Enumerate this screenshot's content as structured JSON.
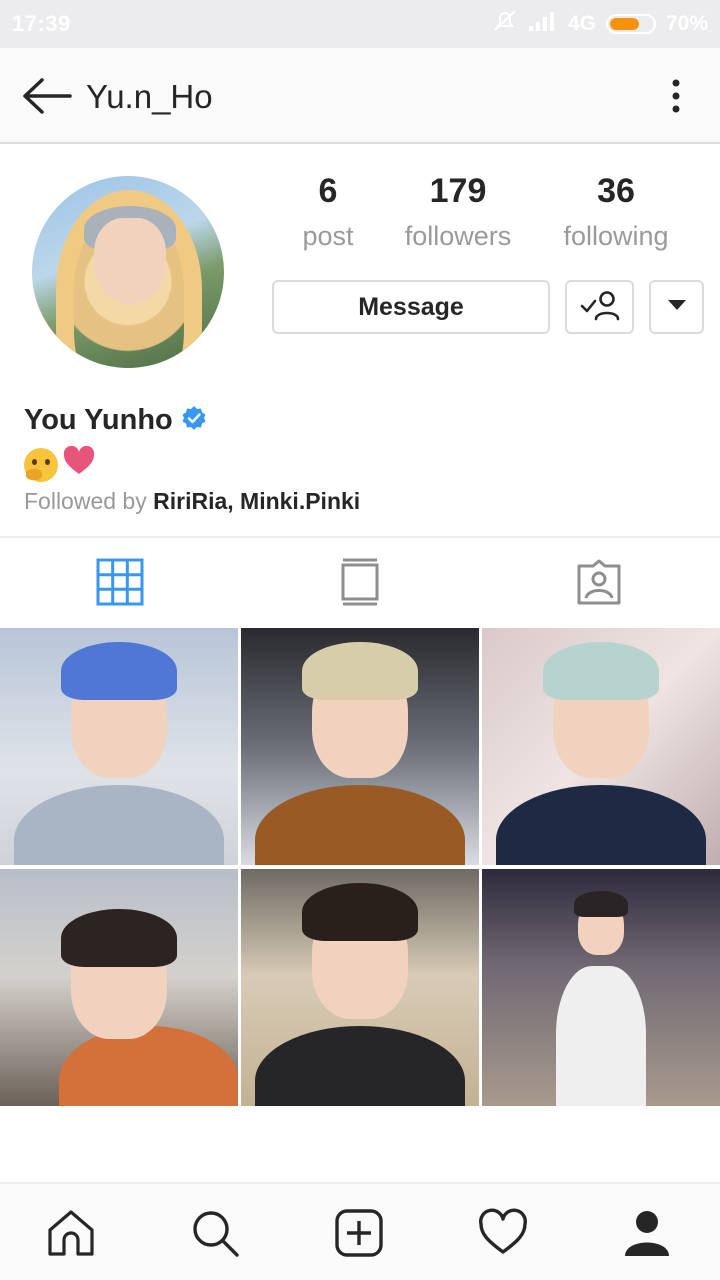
{
  "status_bar": {
    "time": "17:39",
    "network": "4G",
    "battery": "70%",
    "battery_level": 0.7,
    "icons": [
      "mute-icon",
      "signal-icon",
      "battery-icon"
    ]
  },
  "header": {
    "username": "Yu.n_Ho",
    "back_icon": "arrow-left-icon",
    "menu_icon": "more-vertical-icon"
  },
  "profile": {
    "stats": [
      {
        "value": "6",
        "label": "post"
      },
      {
        "value": "179",
        "label": "followers"
      },
      {
        "value": "36",
        "label": "following"
      }
    ],
    "message_label": "Message",
    "full_name": "You Yunho",
    "verified": true,
    "bio_emojis": [
      "thinking-face",
      "heart"
    ],
    "followed_prefix": "Followed by ",
    "followed_names": "RiriRia, Minki.Pinki"
  },
  "tabs": [
    {
      "icon": "grid-icon",
      "active": true
    },
    {
      "icon": "feed-icon",
      "active": false
    },
    {
      "icon": "tagged-icon",
      "active": false
    }
  ],
  "posts": [
    {
      "name": "post-1"
    },
    {
      "name": "post-2"
    },
    {
      "name": "post-3"
    },
    {
      "name": "post-4"
    },
    {
      "name": "post-5"
    },
    {
      "name": "post-6"
    }
  ],
  "bottom_nav": [
    "home-icon",
    "search-icon",
    "new-post-icon",
    "activity-icon",
    "profile-icon"
  ],
  "colors": {
    "accent": "#3897f0",
    "text": "#262626",
    "muted": "#999999",
    "heart": "#e8557a",
    "battery": "#f5940c"
  }
}
